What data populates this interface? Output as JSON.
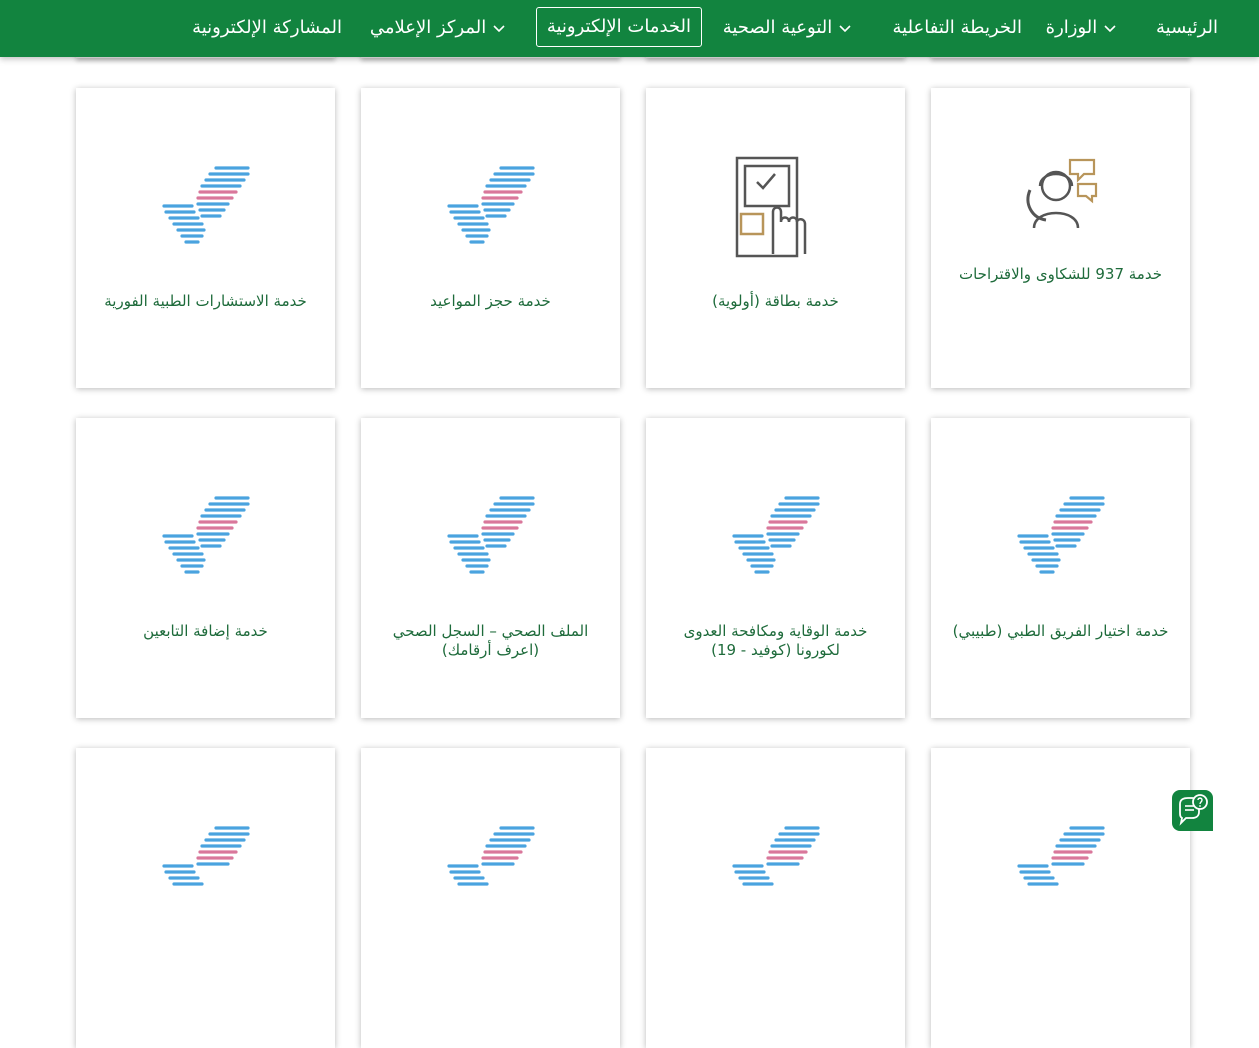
{
  "nav": {
    "items": [
      {
        "label": "الرئيسية"
      },
      {
        "label": "الوزارة",
        "has_dropdown": true
      },
      {
        "label": "الخريطة التفاعلية"
      },
      {
        "label": "التوعية الصحية",
        "has_dropdown": true
      },
      {
        "label": "الخدمات الإلكترونية",
        "active": true
      },
      {
        "label": "المركز الإعلامي",
        "has_dropdown": true
      },
      {
        "label": "المشاركة الإلكترونية"
      }
    ]
  },
  "services": [
    {
      "title": "خدمة 937 للشكاوى والاقتراحات",
      "icon": "call-center-icon"
    },
    {
      "title": "خدمة بطاقة (أولوية)",
      "icon": "priority-card-icon"
    },
    {
      "title": "خدمة حجز المواعيد",
      "icon": "checkmark-icon"
    },
    {
      "title": "خدمة الاستشارات الطبية الفورية",
      "icon": "checkmark-icon"
    },
    {
      "title": "خدمة اختيار الفريق الطبي (طبيبي)",
      "icon": "checkmark-icon"
    },
    {
      "title": "خدمة الوقاية ومكافحة العدوى لكورونا (كوفيد - 19)",
      "icon": "checkmark-icon"
    },
    {
      "title": "الملف الصحي – السجل الصحي (اعرف أرقامك)",
      "icon": "checkmark-icon"
    },
    {
      "title": "خدمة إضافة التابعين",
      "icon": "checkmark-icon"
    },
    {
      "title": "",
      "icon": "checkmark-icon"
    },
    {
      "title": "",
      "icon": "checkmark-icon"
    },
    {
      "title": "",
      "icon": "checkmark-icon"
    },
    {
      "title": "",
      "icon": "checkmark-icon"
    }
  ],
  "chat": {
    "icon": "chat-help-icon"
  },
  "colors": {
    "brand_green": "#12843f",
    "label_green": "#1e6b3b",
    "accent_gold": "#b8955a",
    "stripe_blue": "#4aa3df",
    "stripe_pink": "#d9779b"
  }
}
